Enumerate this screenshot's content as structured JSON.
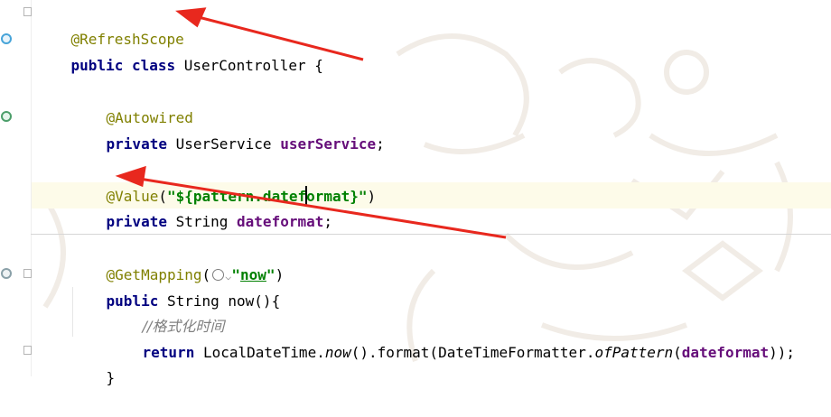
{
  "code": {
    "refresh_scope": "@RefreshScope",
    "class_kw": "public class ",
    "class_name": "UserController {",
    "autowired": "@Autowired",
    "private_kw": "private ",
    "user_service_type": "UserService ",
    "user_service_field": "userService",
    "semicolon": ";",
    "value_ann": "@Value",
    "paren_open": "(",
    "value_string": "\"${pattern.dateformat}\"",
    "paren_close": ")",
    "string_type": "String ",
    "dateformat_field": "dateformat",
    "getmapping": "@GetMapping",
    "get_paren_open": "(",
    "now_string_q1": "\"",
    "now_string_word": "now",
    "now_string_q2": "\"",
    "get_paren_close": ")",
    "public_kw": "public ",
    "method_sig": "String now(){",
    "comment": "//格式化时间",
    "return_kw": "return ",
    "ldt": "LocalDateTime.",
    "now_call": "now",
    "format_call": "().format(DateTimeFormatter.",
    "ofpattern": "ofPattern",
    "open": "(",
    "dateformat_arg": "dateformat",
    "close": "));",
    "close_brace": "}"
  },
  "colors": {
    "keyword": "#000080",
    "annotation": "#808000",
    "string": "#008000",
    "field": "#660e7a",
    "comment": "#808080",
    "arrow": "#e8281e"
  },
  "icons": [
    "bean-gutter-icon",
    "web-gutter-icon",
    "fold-icon",
    "globe-icon",
    "chevron-down-icon"
  ]
}
